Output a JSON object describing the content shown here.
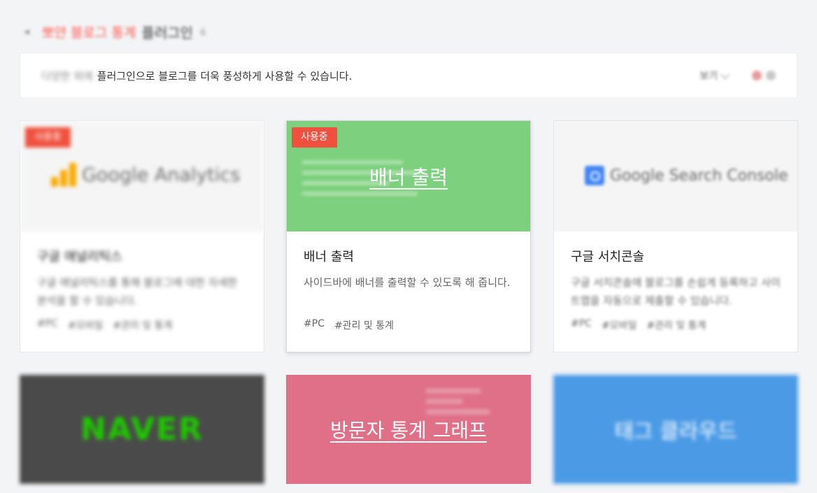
{
  "header": {
    "breadcrumb": "뽀얀 블로그 통계",
    "title": "플러그인",
    "count": "6"
  },
  "info_bar": {
    "lead": "다양한 외에",
    "text": "플러그인으로 블로그를 더욱 풍성하게 사용할 수 있습니다.",
    "view_label": "보기"
  },
  "colors": {
    "accent": "#f0513f",
    "banner_green": "#7dd07e",
    "naver_dark": "#4a4a4a",
    "pink": "#df7088",
    "blue": "#4a9ae6"
  },
  "plugins": [
    {
      "name": "구글 애널리틱스",
      "desc": "구글 애널리틱스를 통해 블로그에 대한 자세한 분석을 할 수 있습니다.",
      "tags": [
        "#PC",
        "#모바일",
        "#관리 및 통계"
      ],
      "badge": "사용중",
      "logo_text": "Google Analytics"
    },
    {
      "name": "배너 출력",
      "desc": "사이드바에 배너를 출력할 수 있도록 해 줍니다.",
      "tags": [
        "#PC",
        "#관리 및 통계"
      ],
      "badge": "사용중",
      "thumb_title": "배너 출력"
    },
    {
      "name": "구글 서치콘솔",
      "desc": "구글 서치콘솔에 블로그를 손쉽게 등록하고 사이트맵을 자동으로 제출할 수 있습니다.",
      "tags": [
        "#PC",
        "#모바일",
        "#관리 및 통계"
      ],
      "logo_text": "Google Search Console"
    },
    {
      "thumb_title": "NAVER"
    },
    {
      "thumb_title": "방문자 통계 그래프"
    },
    {
      "thumb_title": "태그 클라우드"
    }
  ]
}
